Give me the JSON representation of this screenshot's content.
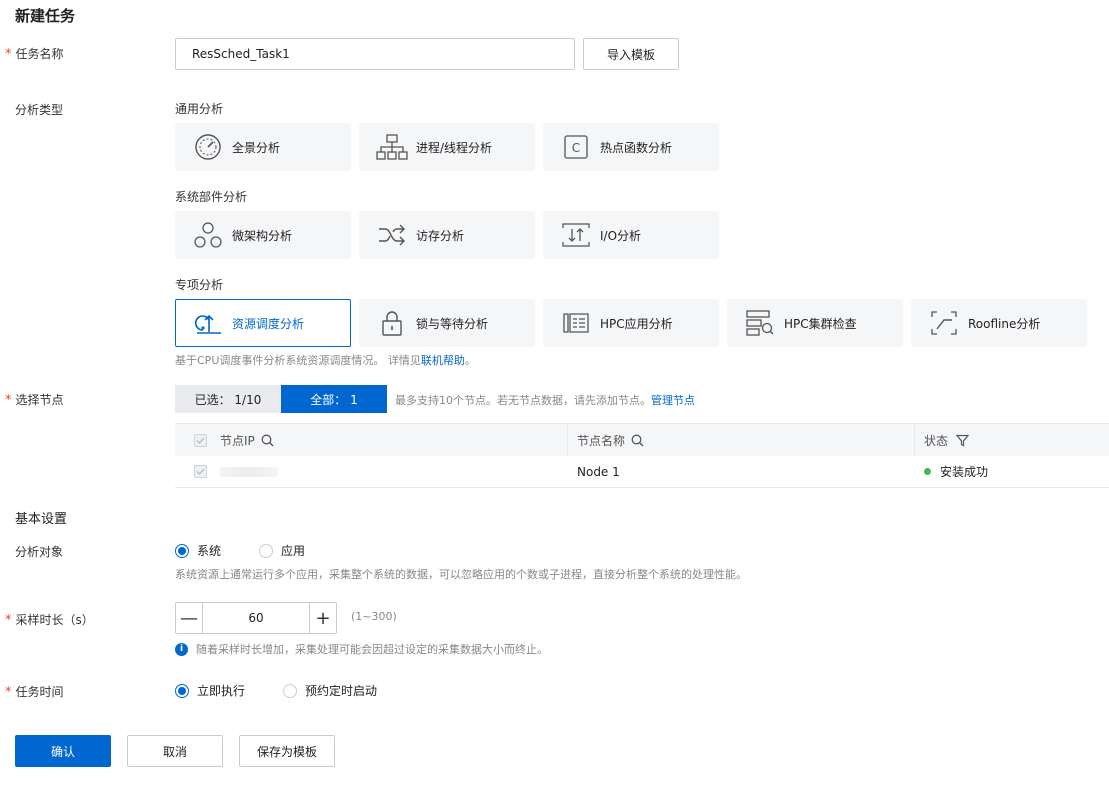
{
  "page": {
    "title": "新建任务"
  },
  "task_name": {
    "label": "任务名称",
    "required": "*",
    "value": "ResSched_Task1",
    "import_btn": "导入模板"
  },
  "analysis_type": {
    "label": "分析类型",
    "groups": [
      {
        "title": "通用分析",
        "items": [
          {
            "label": "全景分析",
            "icon": "gauge-icon"
          },
          {
            "label": "进程/线程分析",
            "icon": "hierarchy-icon"
          },
          {
            "label": "热点函数分析",
            "icon": "function-c-icon"
          }
        ]
      },
      {
        "title": "系统部件分析",
        "items": [
          {
            "label": "微架构分析",
            "icon": "molecule-icon"
          },
          {
            "label": "访存分析",
            "icon": "shuffle-icon"
          },
          {
            "label": "I/O分析",
            "icon": "io-icon"
          }
        ]
      },
      {
        "title": "专项分析",
        "items": [
          {
            "label": "资源调度分析",
            "icon": "schedule-icon"
          },
          {
            "label": "锁与等待分析",
            "icon": "lock-icon"
          },
          {
            "label": "HPC应用分析",
            "icon": "hpc-app-icon"
          },
          {
            "label": "HPC集群检查",
            "icon": "cluster-check-icon"
          },
          {
            "label": "Roofline分析",
            "icon": "roofline-icon"
          }
        ]
      }
    ],
    "hint_text": "基于CPU调度事件分析系统资源调度情况。 详情见",
    "hint_link": "联机帮助",
    "hint_end": "。"
  },
  "node_select": {
    "label": "选择节点",
    "required": "*",
    "selected_tab": "已选： 1/10",
    "all_tab": "全部： 1",
    "hint": "最多支持10个节点。若无节点数据，请先添加节点。",
    "manage_link": "管理节点",
    "columns": [
      "节点IP",
      "节点名称",
      "状态"
    ],
    "rows": [
      {
        "ip": "",
        "name": "Node 1",
        "status": "安装成功",
        "status_color": "#3fb950"
      }
    ]
  },
  "basic": {
    "title": "基本设置",
    "target": {
      "label": "分析对象",
      "options": [
        "系统",
        "应用"
      ],
      "selected": 0,
      "hint": "系统资源上通常运行多个应用，采集整个系统的数据，可以忽略应用的个数或子进程，直接分析整个系统的处理性能。"
    },
    "duration": {
      "label": "采样时长（s）",
      "required": "*",
      "value": "60",
      "range": "(1~300)",
      "minus": "—",
      "plus": "+",
      "info_glyph": "i",
      "hint": "随着采样时长增加，采集处理可能会因超过设定的采集数据大小而终止。"
    },
    "task_time": {
      "label": "任务时间",
      "required": "*",
      "options": [
        "立即执行",
        "预约定时启动"
      ],
      "selected": 0
    }
  },
  "footer": {
    "confirm": "确认",
    "cancel": "取消",
    "save_template": "保存为模板"
  },
  "colors": {
    "primary": "#0067d1",
    "required": "#e54545",
    "card_bg": "#f5f6f8"
  }
}
